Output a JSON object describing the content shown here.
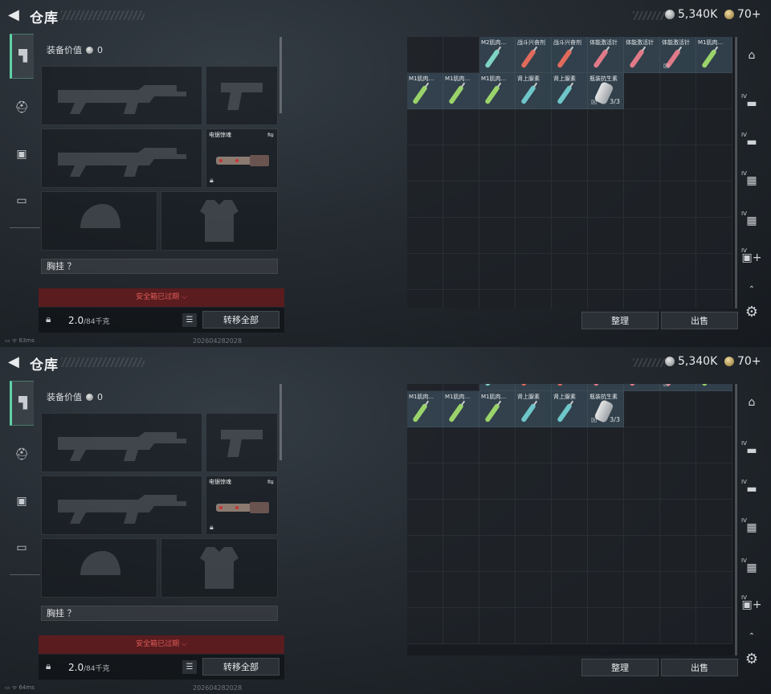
{
  "header": {
    "title": "仓库",
    "silver": "5,340K",
    "gold": "70+"
  },
  "sidebar": {
    "items": [
      {
        "icon": "pistol-icon",
        "glyph": "▜"
      },
      {
        "icon": "helmet-icon",
        "glyph": "⛑"
      },
      {
        "icon": "vest-icon",
        "glyph": "▣"
      },
      {
        "icon": "toolbox-icon",
        "glyph": "▭"
      }
    ]
  },
  "equip": {
    "value_label": "装备价值",
    "value": "0",
    "melee_label": "电锯惊魂",
    "chest_label": "胸挂 ？",
    "safe_label": "安全箱已过期 ⌵",
    "weight_value": "2.0",
    "weight_cap": "/84千克",
    "transfer_all": "转移全部"
  },
  "inventory": {
    "items": [
      {
        "name": "M2肌肉...",
        "color": "#7fd3c2"
      },
      {
        "name": "战斗兴奋剂",
        "color": "#e06a5c"
      },
      {
        "name": "战斗兴奋剂",
        "color": "#e06a5c"
      },
      {
        "name": "体能激活针",
        "color": "#e07a88"
      },
      {
        "name": "体能激活针",
        "color": "#e07a88"
      },
      {
        "name": "体能激活针",
        "color": "#e07a88",
        "tag": "☒"
      },
      {
        "name": "M1肌肉...",
        "color": "#9bd36b"
      },
      {
        "name": "M1肌肉...",
        "color": "#9bd36b"
      },
      {
        "name": "M1肌肉...",
        "color": "#9bd36b"
      },
      {
        "name": "M1肌肉...",
        "color": "#9bd36b"
      },
      {
        "name": "肾上腺素",
        "color": "#6fc6c9"
      },
      {
        "name": "肾上腺素",
        "color": "#6fc6c9"
      },
      {
        "name": "瓶装抗生素",
        "kind": "pill",
        "count": "3/3",
        "tag": "☒"
      }
    ],
    "sort_label": "整理",
    "sell_label": "出售"
  },
  "rail": {
    "items": [
      {
        "icon": "backpack-icon",
        "glyph": "⌂",
        "iv": ""
      },
      {
        "icon": "case-iv-icon",
        "glyph": "▬",
        "iv": "IV"
      },
      {
        "icon": "case-iv-2-icon",
        "glyph": "▬",
        "iv": "IV"
      },
      {
        "icon": "case-iv-3-icon",
        "glyph": "▦",
        "iv": "IV"
      },
      {
        "icon": "case-iv-4-icon",
        "glyph": "▦",
        "iv": "IV"
      },
      {
        "icon": "add-case-icon",
        "glyph": "▣+",
        "iv": "IV"
      }
    ],
    "chevron": "⌃",
    "settings": "⚙"
  },
  "shots": [
    {
      "ping": "63ms",
      "timestamp": "202604282028",
      "grid_scroll": 0
    },
    {
      "ping": "64ms",
      "timestamp": "202604282028",
      "grid_scroll": 36
    }
  ]
}
